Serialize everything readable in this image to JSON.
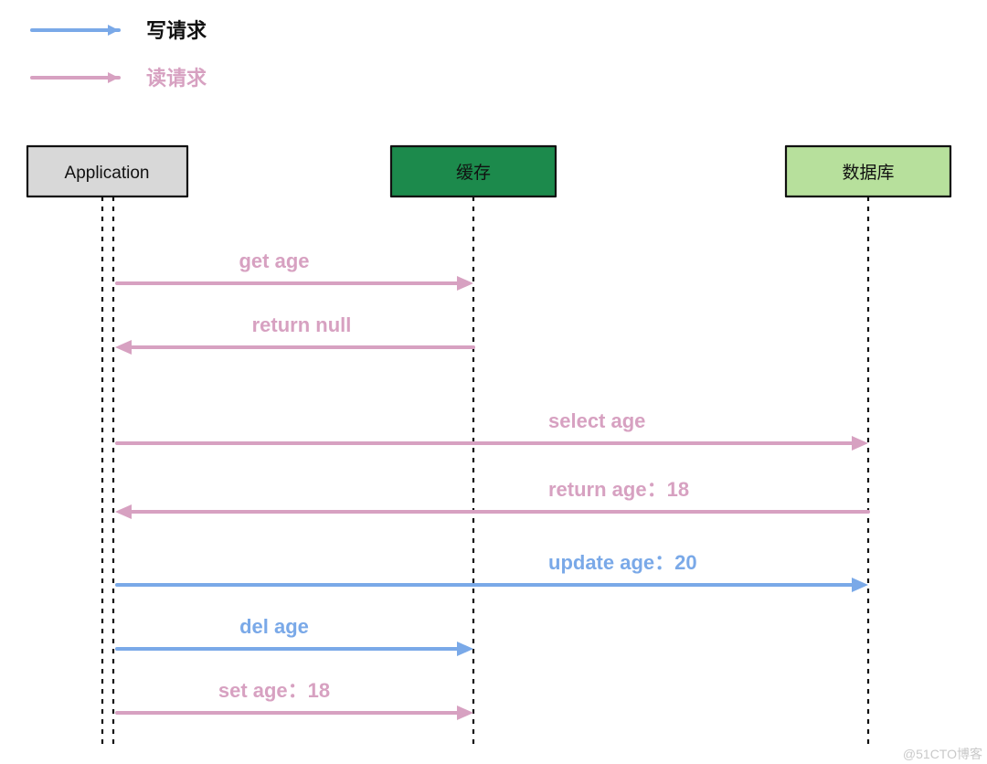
{
  "legend": {
    "write": "写请求",
    "read": "读请求"
  },
  "actors": {
    "app": "Application",
    "cache": "缓存",
    "db": "数据库"
  },
  "messages": {
    "get_age": "get age",
    "return_null": "return null",
    "select_age": "select age",
    "return_age_18": "return age：18",
    "update_age_20": "update age：20",
    "del_age": "del age",
    "set_age_18": "set age：18"
  },
  "colors": {
    "read": "#d7a1c1",
    "write": "#7aa9e8",
    "app_box": "#d8d8d8",
    "cache_box": "#1c8a4c",
    "db_box": "#b7e09c"
  },
  "watermark": "@51CTO博客"
}
